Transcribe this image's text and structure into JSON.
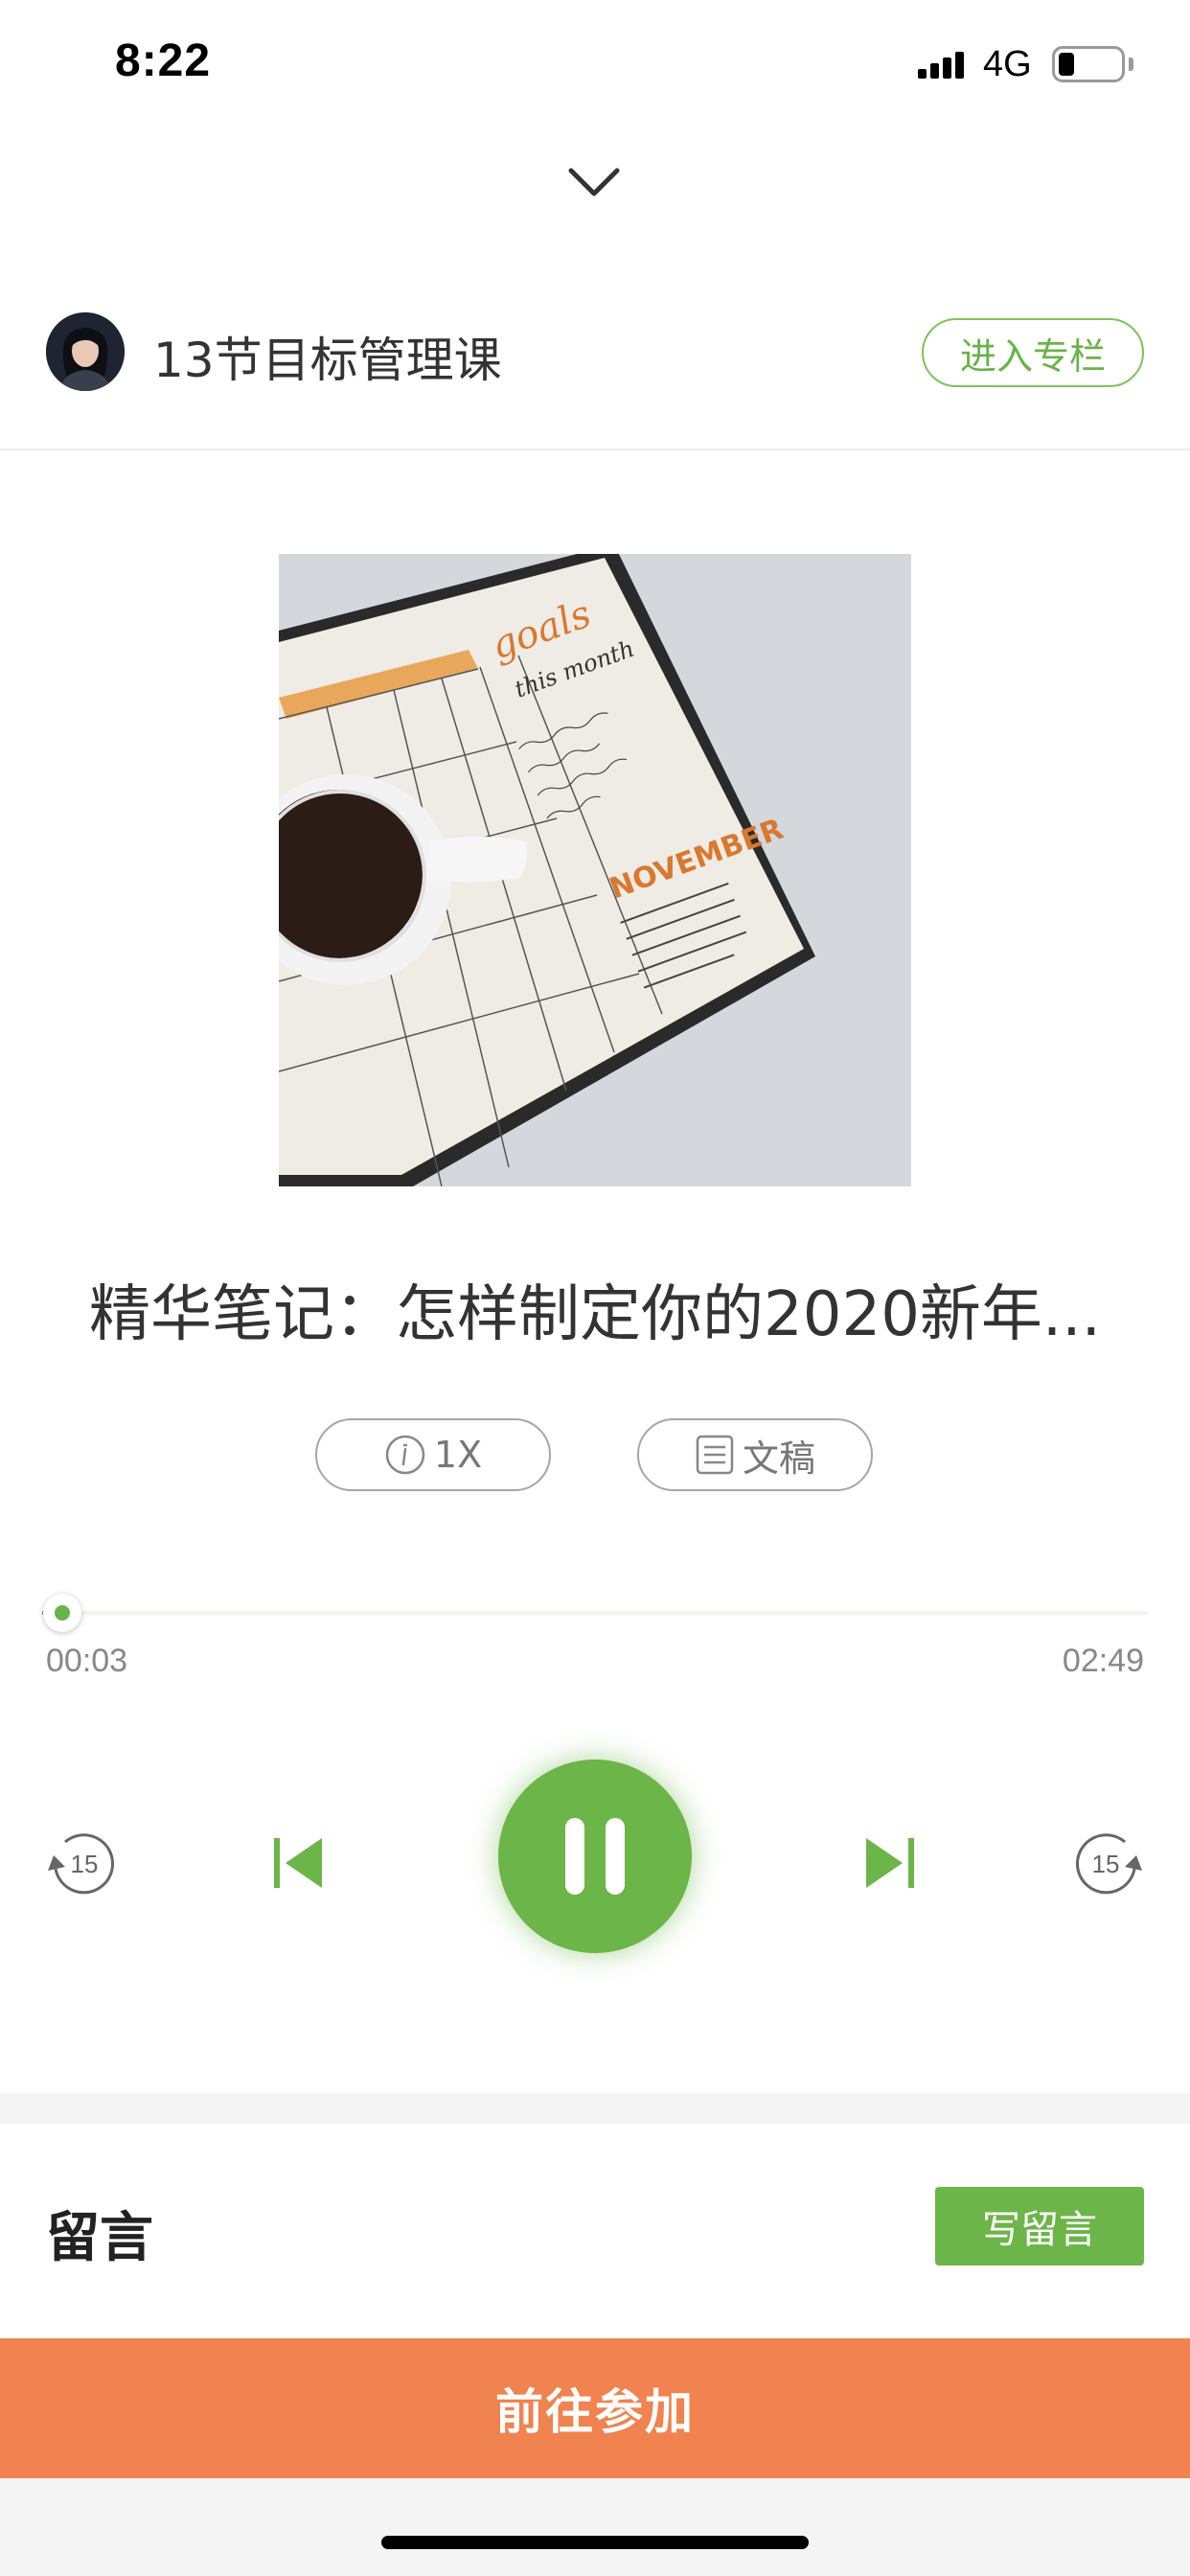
{
  "status_bar": {
    "time": "8:22",
    "network": "4G"
  },
  "course": {
    "title": "13节目标管理课",
    "enter_label": "进入专栏"
  },
  "episode": {
    "title": "精华笔记：怎样制定你的2020新年..."
  },
  "controls": {
    "speed_label": "1X",
    "script_label": "文稿",
    "current_time": "00:03",
    "total_time": "02:49",
    "progress_fraction": 0.018,
    "skip_seconds": "15"
  },
  "comments": {
    "title": "留言",
    "write_label": "写留言"
  },
  "cta": {
    "join_label": "前往参加"
  },
  "cover": {
    "goals_text": "goals",
    "this_month_text": "this month",
    "month_text": "NOVEMBER"
  },
  "colors": {
    "accent_green": "#6cb548",
    "cta_orange": "#f0834f",
    "text_dark": "#333333",
    "text_muted": "#888888"
  }
}
